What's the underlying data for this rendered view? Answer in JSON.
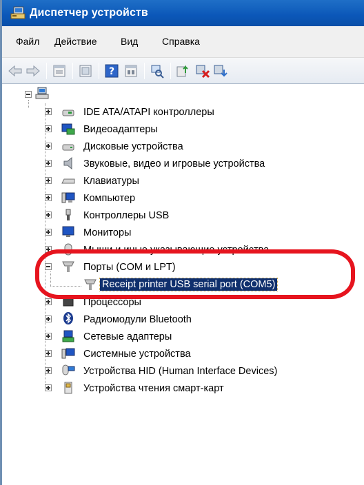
{
  "window": {
    "title": "Диспетчер устройств"
  },
  "menu": {
    "items": [
      {
        "label": "Файл"
      },
      {
        "label": "Действие"
      },
      {
        "label": "Вид"
      },
      {
        "label": "Справка"
      }
    ]
  },
  "toolbar": {
    "buttons": [
      "back-arrow-icon",
      "forward-arrow-icon",
      "properties-icon",
      "show-hide-tree-icon",
      "help-icon",
      "action-icon",
      "scan-hardware-icon",
      "update-driver-icon",
      "uninstall-icon",
      "enable-device-icon"
    ]
  },
  "tree": {
    "root": {
      "icon": "computer-icon"
    },
    "categories": [
      {
        "label": "IDE ATA/ATAPI контроллеры",
        "icon": "ide-controller-icon",
        "expanded": false
      },
      {
        "label": "Видеоадаптеры",
        "icon": "display-adapter-icon",
        "expanded": false
      },
      {
        "label": "Дисковые устройства",
        "icon": "disk-drive-icon",
        "expanded": false
      },
      {
        "label": "Звуковые, видео и игровые устройства",
        "icon": "speaker-icon",
        "expanded": false
      },
      {
        "label": "Клавиатуры",
        "icon": "keyboard-icon",
        "expanded": false
      },
      {
        "label": "Компьютер",
        "icon": "computer-icon",
        "expanded": false
      },
      {
        "label": "Контроллеры USB",
        "icon": "usb-icon",
        "expanded": false
      },
      {
        "label": "Мониторы",
        "icon": "monitor-icon",
        "expanded": false
      },
      {
        "label": "Мыши и иные указывающие устройства",
        "icon": "mouse-icon",
        "expanded": false
      },
      {
        "label": "Порты (COM и LPT)",
        "icon": "port-icon",
        "expanded": true,
        "children": [
          {
            "label": "Receipt printer USB serial port (COM5)",
            "icon": "port-icon",
            "selected": true
          }
        ]
      },
      {
        "label": "Процессоры",
        "icon": "processor-icon",
        "expanded": false
      },
      {
        "label": "Радиомодули Bluetooth",
        "icon": "bluetooth-icon",
        "expanded": false
      },
      {
        "label": "Сетевые адаптеры",
        "icon": "network-adapter-icon",
        "expanded": false
      },
      {
        "label": "Системные устройства",
        "icon": "system-devices-icon",
        "expanded": false
      },
      {
        "label": "Устройства HID (Human Interface Devices)",
        "icon": "hid-icon",
        "expanded": false
      },
      {
        "label": "Устройства чтения смарт-карт",
        "icon": "smart-card-reader-icon",
        "expanded": false
      }
    ]
  },
  "colors": {
    "titlebar": "#0b57b8",
    "selection": "#0f2f6d",
    "annotation": "#e6141e"
  }
}
